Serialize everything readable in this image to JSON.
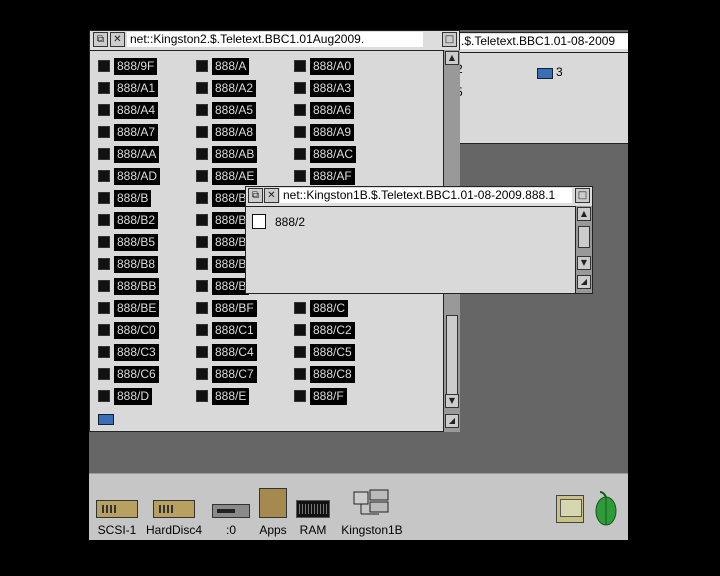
{
  "win_main": {
    "title": "net::Kingston2.$.Teletext.BBC1.01Aug2009.",
    "files": [
      [
        "888/9F",
        "888/A",
        "888/A0"
      ],
      [
        "888/A1",
        "888/A2",
        "888/A3"
      ],
      [
        "888/A4",
        "888/A5",
        "888/A6"
      ],
      [
        "888/A7",
        "888/A8",
        "888/A9"
      ],
      [
        "888/AA",
        "888/AB",
        "888/AC"
      ],
      [
        "888/AD",
        "888/AE",
        "888/AF"
      ],
      [
        "888/B",
        "888/B",
        ""
      ],
      [
        "888/B2",
        "888/B",
        ""
      ],
      [
        "888/B5",
        "888/B",
        ""
      ],
      [
        "888/B8",
        "888/B",
        ""
      ],
      [
        "888/BB",
        "888/B",
        ""
      ],
      [
        "888/BE",
        "888/BF",
        "888/C"
      ],
      [
        "888/C0",
        "888/C1",
        "888/C2"
      ],
      [
        "888/C3",
        "888/C4",
        "888/C5"
      ],
      [
        "888/C6",
        "888/C7",
        "888/C8"
      ],
      [
        "888/D",
        "888/E",
        "888/F"
      ]
    ]
  },
  "win_back": {
    "title": ".$.Teletext.BBC1.01-08-2009",
    "item_partial_1": "2",
    "item_partial_2": "5",
    "dir_label": "3"
  },
  "win_front": {
    "title": "net::Kingston1B.$.Teletext.BBC1.01-08-2009.888.1",
    "file": "888/2"
  },
  "iconbar": {
    "items": [
      {
        "label": "SCSI-1",
        "icon": "hard-drive-icon"
      },
      {
        "label": "HardDisc4",
        "icon": "hard-drive-icon"
      },
      {
        "label": ":0",
        "icon": "floppy-drive-icon"
      },
      {
        "label": "Apps",
        "icon": "apps-folder-icon"
      },
      {
        "label": "RAM",
        "icon": "ram-disc-icon"
      },
      {
        "label": "Kingston1B",
        "icon": "network-drive-icon"
      }
    ],
    "right_icons": [
      "display-icon",
      "acorn-icon"
    ]
  },
  "colors": {
    "window_bg": "#d9d9d9",
    "desktop": "#666666",
    "iconbar": "#c6c6c6",
    "selected_label_bg": "#000000"
  }
}
